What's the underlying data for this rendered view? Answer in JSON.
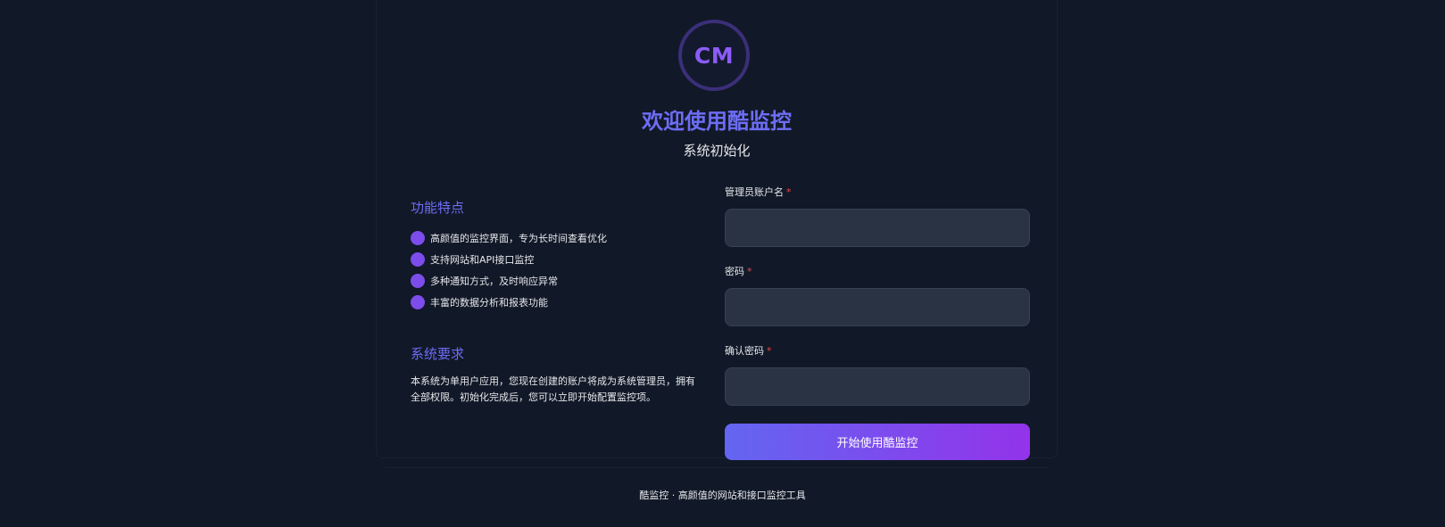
{
  "logo": {
    "text": "CM",
    "color": "#8b5cf6"
  },
  "header": {
    "title": "欢迎使用酷监控",
    "subtitle": "系统初始化"
  },
  "features": {
    "title": "功能特点",
    "items": [
      "高颜值的监控界面，专为长时间查看优化",
      "支持网站和API接口监控",
      "多种通知方式，及时响应异常",
      "丰富的数据分析和报表功能"
    ],
    "icon": "purple-dot-icon"
  },
  "requirements": {
    "title": "系统要求",
    "text": "本系统为单用户应用，您现在创建的账户将成为系统管理员，拥有全部权限。初始化完成后，您可以立即开始配置监控项。"
  },
  "form": {
    "username": {
      "label": "管理员账户名",
      "required": "*",
      "value": ""
    },
    "password": {
      "label": "密码",
      "required": "*",
      "value": ""
    },
    "confirm": {
      "label": "确认密码",
      "required": "*",
      "value": ""
    },
    "submit_label": "开始使用酷监控"
  },
  "footer": {
    "text": "酷监控 · 高颜值的网站和接口监控工具"
  },
  "colors": {
    "background": "#111827",
    "accent": "#6d6df5",
    "button_gradient_start": "#6366f1",
    "button_gradient_end": "#9333ea",
    "required_star": "#ef4444",
    "input_bg": "#2a3343"
  }
}
